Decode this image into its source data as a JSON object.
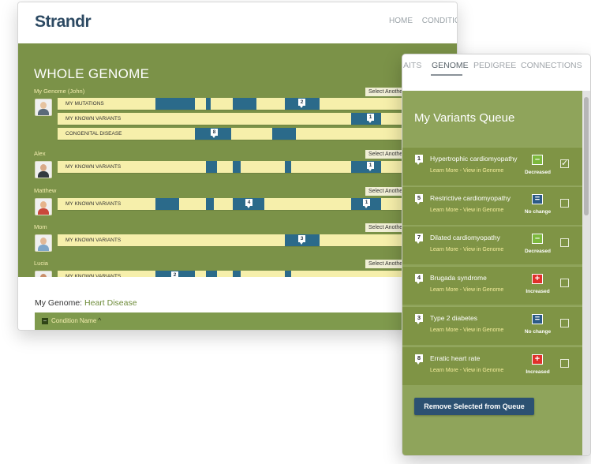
{
  "app": {
    "logo": "Strandr"
  },
  "nav": {
    "items": [
      "HOME",
      "CONDITIONS"
    ]
  },
  "genome": {
    "title": "WHOLE GENOME",
    "select_label": "Select Another",
    "people": [
      {
        "name": "My Genome (John)",
        "avatar": "john",
        "tracks": [
          {
            "label": "MY MUTATIONS",
            "badge": "2"
          },
          {
            "label": "MY KNOWN VARIANTS",
            "badge": "1"
          },
          {
            "label": "CONGENITAL DISEASE",
            "badge": "8"
          }
        ]
      },
      {
        "name": "Alex",
        "avatar": "alex",
        "tracks": [
          {
            "label": "MY KNOWN VARIANTS",
            "badge": "1"
          }
        ]
      },
      {
        "name": "Matthew",
        "avatar": "matthew",
        "tracks": [
          {
            "label": "MY KNOWN VARIANTS",
            "badge": "4",
            "badge2": "1"
          }
        ]
      },
      {
        "name": "Mom",
        "avatar": "mom",
        "tracks": [
          {
            "label": "MY KNOWN VARIANTS",
            "badge": "3"
          }
        ]
      },
      {
        "name": "Lucia",
        "avatar": "lucia",
        "tracks": [
          {
            "label": "MY KNOWN VARIANTS",
            "badge": "2"
          }
        ]
      }
    ]
  },
  "lower": {
    "title_prefix": "My Genome:",
    "title_value": "Heart Disease",
    "column_header": "Condition Name",
    "collapse_glyph": "–",
    "sort_glyph": "^"
  },
  "panel": {
    "tabs": [
      "AITS",
      "GENOME",
      "PEDIGREE",
      "CONNECTIONS"
    ],
    "active_tab": "GENOME",
    "queue_title": "My Variants Queue",
    "items": [
      {
        "num": "1",
        "name": "Hypertrophic cardiomyopathy",
        "links": "Learn More - View in Genome",
        "status": "Decreased",
        "glyph": "–",
        "checked": true
      },
      {
        "num": "5",
        "name": "Restrictive cardiomyopathy",
        "links": "Learn More - View in Genome",
        "status": "No change",
        "glyph": "=",
        "checked": false
      },
      {
        "num": "7",
        "name": "Dilated cardiomyopathy",
        "links": "Learn More - View in Genome",
        "status": "Decreased",
        "glyph": "–",
        "checked": false
      },
      {
        "num": "4",
        "name": "Brugada syndrome",
        "links": "Learn More - View in Genome",
        "status": "Increased",
        "glyph": "+",
        "checked": false
      },
      {
        "num": "3",
        "name": "Type 2 diabetes",
        "links": "Learn More - View in Genome",
        "status": "No change",
        "glyph": "=",
        "checked": false
      },
      {
        "num": "8",
        "name": "Erratic heart rate",
        "links": "Learn More - View in Genome",
        "status": "Increased",
        "glyph": "+",
        "checked": false
      }
    ],
    "remove_button": "Remove Selected from Queue"
  },
  "colors": {
    "olive": "#7b9248",
    "track": "#f6efab",
    "segment": "#2b6a8a",
    "increased": "#e0302a",
    "decreased": "#7cb83d",
    "no_change": "#2c5a86",
    "button": "#2c5172"
  }
}
